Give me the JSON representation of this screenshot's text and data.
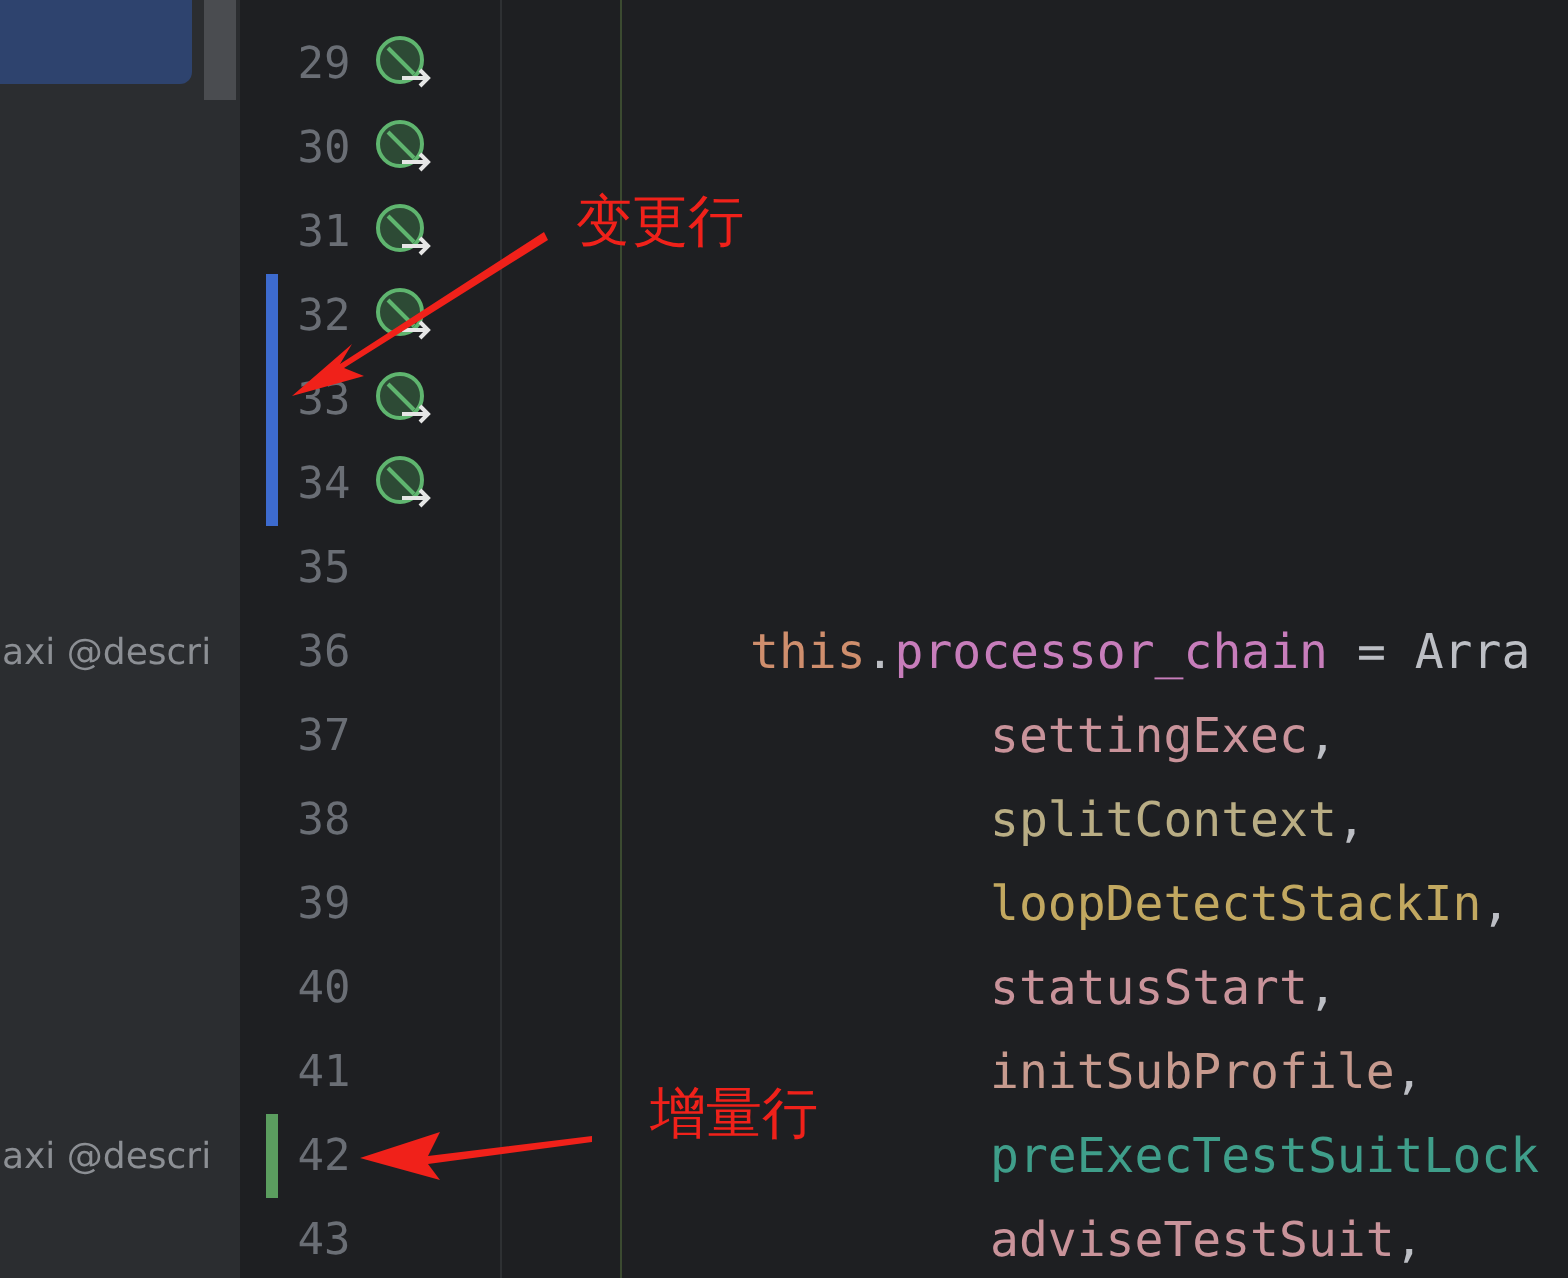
{
  "editor": {
    "lines": [
      {
        "number": "29",
        "gutter_icon": true,
        "modified": false,
        "added": false
      },
      {
        "number": "30",
        "gutter_icon": true,
        "modified": false,
        "added": false
      },
      {
        "number": "31",
        "gutter_icon": true,
        "modified": false,
        "added": false
      },
      {
        "number": "32",
        "gutter_icon": true,
        "modified": true,
        "added": false
      },
      {
        "number": "33",
        "gutter_icon": true,
        "modified": true,
        "added": false
      },
      {
        "number": "34",
        "gutter_icon": true,
        "modified": true,
        "added": false
      },
      {
        "number": "35",
        "gutter_icon": false,
        "modified": false,
        "added": false
      },
      {
        "number": "36",
        "gutter_icon": false,
        "modified": false,
        "added": false,
        "sidebar_text": "axi @descri",
        "tokens": [
          {
            "text": "this",
            "color": "#cf8e6d"
          },
          {
            "text": ".",
            "color": "#bcbec4"
          },
          {
            "text": "processor_chain",
            "color": "#c77dbb"
          },
          {
            "text": " = Arra",
            "color": "#bcbec4"
          }
        ],
        "children": [
          {
            "number": "37",
            "gutter_icon": false,
            "modified": false,
            "added": false,
            "tokens": [
              {
                "text": "settingExec",
                "color": "#c9939a"
              },
              {
                "text": ",",
                "color": "#bcbec4"
              }
            ]
          },
          {
            "number": "38",
            "gutter_icon": false,
            "modified": false,
            "added": false,
            "tokens": [
              {
                "text": "splitContext",
                "color": "#b9ad84"
              },
              {
                "text": ",",
                "color": "#bcbec4"
              }
            ]
          },
          {
            "number": "39",
            "gutter_icon": false,
            "modified": false,
            "added": false,
            "tokens": [
              {
                "text": "loopDetectStackIn",
                "color": "#c2a860"
              },
              {
                "text": ",",
                "color": "#bcbec4"
              }
            ]
          },
          {
            "number": "40",
            "gutter_icon": false,
            "modified": false,
            "added": false,
            "tokens": [
              {
                "text": "statusStart",
                "color": "#c9939a"
              },
              {
                "text": ",",
                "color": "#bcbec4"
              }
            ]
          },
          {
            "number": "41",
            "gutter_icon": false,
            "modified": false,
            "added": false,
            "tokens": [
              {
                "text": "initSubProfile",
                "color": "#c79a8e"
              },
              {
                "text": ",",
                "color": "#bcbec4"
              }
            ]
          },
          {
            "number": "42",
            "gutter_icon": false,
            "modified": false,
            "added": true,
            "sidebar_text": "axi @descri",
            "tokens": [
              {
                "text": "preExecTestSuitLock",
                "color": "#3f9e8a"
              }
            ]
          },
          {
            "number": "43",
            "gutter_icon": false,
            "modified": false,
            "added": false,
            "tokens": [
              {
                "text": "adviseTestSuit",
                "color": "#c9939a"
              },
              {
                "text": ",",
                "color": "#bcbec4"
              }
            ]
          }
        ]
      }
    ]
  },
  "annotations": [
    {
      "text": "变更行"
    },
    {
      "text": "增量行"
    }
  ]
}
